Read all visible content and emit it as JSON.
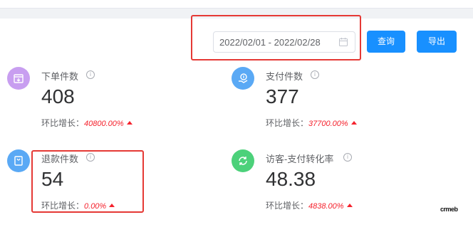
{
  "filter": {
    "date_range": "2022/02/01 - 2022/02/28",
    "query_label": "查询",
    "export_label": "导出"
  },
  "stats": [
    {
      "label": "下单件数",
      "value": "408",
      "growth_label": "环比增长：",
      "growth_value": "40800.00%",
      "icon": "order-box-icon",
      "color": "#c89ef0"
    },
    {
      "label": "支付件数",
      "value": "377",
      "growth_label": "环比增长：",
      "growth_value": "37700.00%",
      "icon": "payment-hand-icon",
      "color": "#5aa9f5"
    },
    {
      "label": "退款件数",
      "value": "54",
      "growth_label": "环比增长：",
      "growth_value": "0.00%",
      "icon": "refund-bag-icon",
      "color": "#5aa9f5"
    },
    {
      "label": "访客-支付转化率",
      "value": "48.38",
      "growth_label": "环比增长：",
      "growth_value": "4838.00%",
      "icon": "refresh-cycle-icon",
      "color": "#4cd17a"
    }
  ],
  "info_glyph": "i",
  "watermark": "crmeb",
  "colors": {
    "primary": "#1890ff",
    "up": "#f5222d",
    "highlight": "#e53935"
  }
}
